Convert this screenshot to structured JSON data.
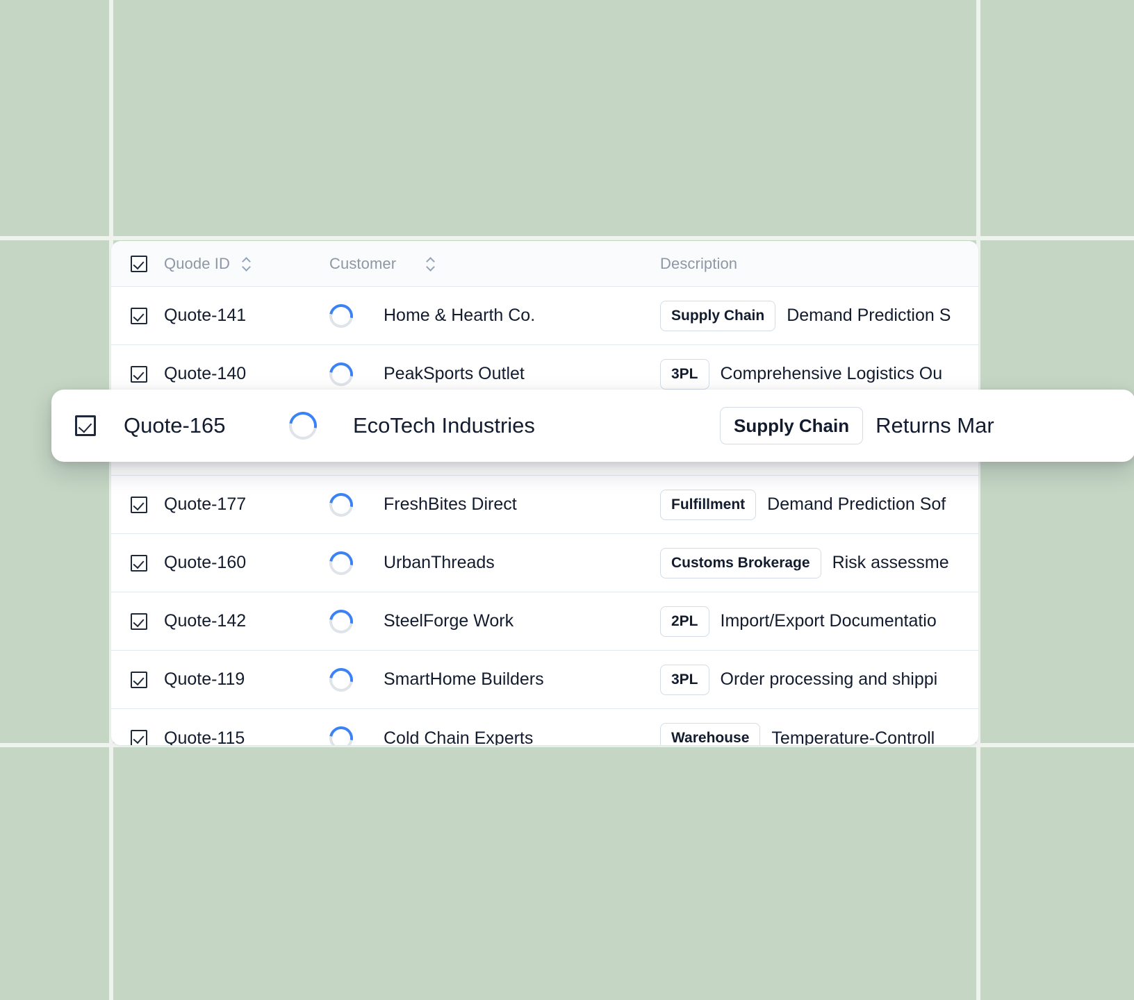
{
  "theme": {
    "background": "#c5d6c4",
    "grid_line": "#eef3ee",
    "card_background": "#ffffff",
    "header_background": "#f9fbfd",
    "text": "#131c2e",
    "muted_text": "#8e97a4",
    "border": "#e2e8f0",
    "chip_border": "#d3dce6",
    "spinner_accent": "#3b82f6",
    "spinner_track": "#dfe4ea"
  },
  "table": {
    "columns": [
      {
        "key": "select",
        "label": "",
        "sortable": false,
        "icon": "checkbox-checked-icon"
      },
      {
        "key": "quote_id",
        "label": "Quode ID",
        "sortable": true,
        "icon": "sort-icon"
      },
      {
        "key": "customer",
        "label": "Customer",
        "sortable": true,
        "icon": "sort-icon"
      },
      {
        "key": "description",
        "label": "Description",
        "sortable": false
      }
    ],
    "header": {
      "select_all_checked": true,
      "quote_id_label": "Quode ID",
      "customer_label": "Customer",
      "description_label": "Description"
    },
    "rows": [
      {
        "selected": true,
        "quote_id": "Quote-141",
        "status_icon": "loading-spinner-icon",
        "customer": "Home & Hearth Co.",
        "chip": "Supply Chain",
        "description": "Demand Prediction S"
      },
      {
        "selected": true,
        "quote_id": "Quote-140",
        "status_icon": "loading-spinner-icon",
        "customer": "PeakSports Outlet",
        "chip": "3PL",
        "description": "Comprehensive Logistics Ou"
      },
      {
        "selected": true,
        "quote_id": "Quote-177",
        "status_icon": "loading-spinner-icon",
        "customer": "FreshBites Direct",
        "chip": "Fulfillment",
        "description": "Demand Prediction Sof"
      },
      {
        "selected": true,
        "quote_id": "Quote-160",
        "status_icon": "loading-spinner-icon",
        "customer": "UrbanThreads",
        "chip": "Customs Brokerage",
        "description": "Risk assessme"
      },
      {
        "selected": true,
        "quote_id": "Quote-142",
        "status_icon": "loading-spinner-icon",
        "customer": "SteelForge Work",
        "chip": "2PL",
        "description": "Import/Export Documentatio"
      },
      {
        "selected": true,
        "quote_id": "Quote-119",
        "status_icon": "loading-spinner-icon",
        "customer": "SmartHome Builders",
        "chip": "3PL",
        "description": "Order processing and shippi"
      },
      {
        "selected": true,
        "quote_id": "Quote-115",
        "status_icon": "loading-spinner-icon",
        "customer": "Cold Chain Experts",
        "chip": "Warehouse",
        "description": "Temperature-Controll"
      }
    ]
  },
  "dragged_row": {
    "selected": true,
    "quote_id": "Quote-165",
    "status_icon": "loading-spinner-icon",
    "customer": "EcoTech Industries",
    "chip": "Supply Chain",
    "description": "Returns Mar"
  }
}
